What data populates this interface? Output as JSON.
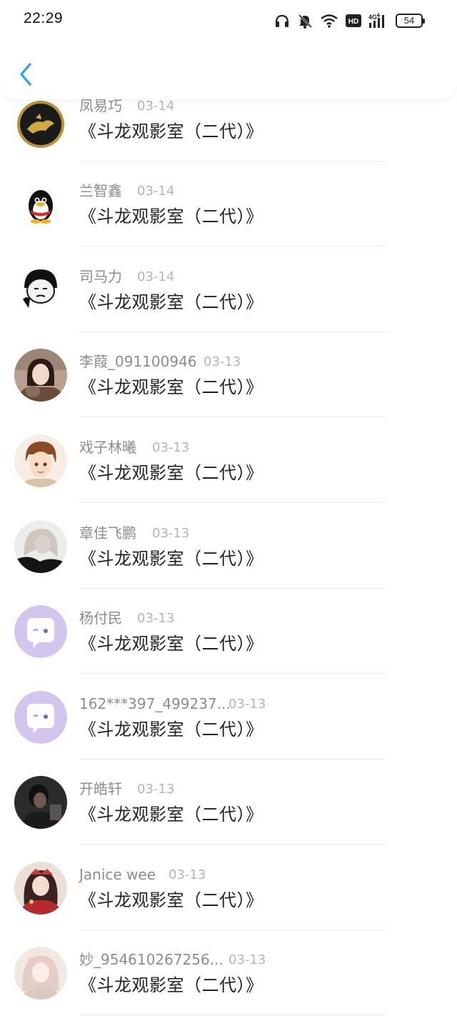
{
  "status_bar": {
    "time": "22:29",
    "battery": "54",
    "icons": [
      "headphones-icon",
      "mute-bell-icon",
      "wifi-icon",
      "hd-icon",
      "4g-signal-icon"
    ]
  },
  "header": {
    "back_icon": "chevron-left-icon",
    "accent": "#2a9df4"
  },
  "items": [
    {
      "name": "凤易巧",
      "date": "03-14",
      "title": "《斗龙观影室（二代）》",
      "avatar": "golden-dragon"
    },
    {
      "name": "兰智鑫",
      "date": "03-14",
      "title": "《斗龙观影室（二代）》",
      "avatar": "penguin"
    },
    {
      "name": "司马力",
      "date": "03-14",
      "title": "《斗龙观影室（二代）》",
      "avatar": "meme-face"
    },
    {
      "name": "李葭_091100946",
      "date": "03-13",
      "title": "《斗龙观影室（二代）》",
      "avatar": "photo-girl"
    },
    {
      "name": "戏子林曦",
      "date": "03-13",
      "title": "《斗龙观影室（二代）》",
      "avatar": "anime-boy"
    },
    {
      "name": "章佳飞鹏",
      "date": "03-13",
      "title": "《斗龙观影室（二代）》",
      "avatar": "photo-blonde"
    },
    {
      "name": "杨付民",
      "date": "03-13",
      "title": "《斗龙观影室（二代）》",
      "avatar": "default-purple"
    },
    {
      "name": "162***397_499237...",
      "date": "03-13",
      "title": "《斗龙观影室（二代）》",
      "avatar": "default-purple"
    },
    {
      "name": "开皓轩",
      "date": "03-13",
      "title": "《斗龙观影室（二代）》",
      "avatar": "photo-dark"
    },
    {
      "name": "Janice wee",
      "date": "03-13",
      "title": "《斗龙观影室（二代）》",
      "avatar": "anime-girl-red"
    },
    {
      "name": "妙_954610267256...",
      "date": "03-13",
      "title": "《斗龙观影室（二代）》",
      "avatar": "anime-girl-light"
    }
  ]
}
